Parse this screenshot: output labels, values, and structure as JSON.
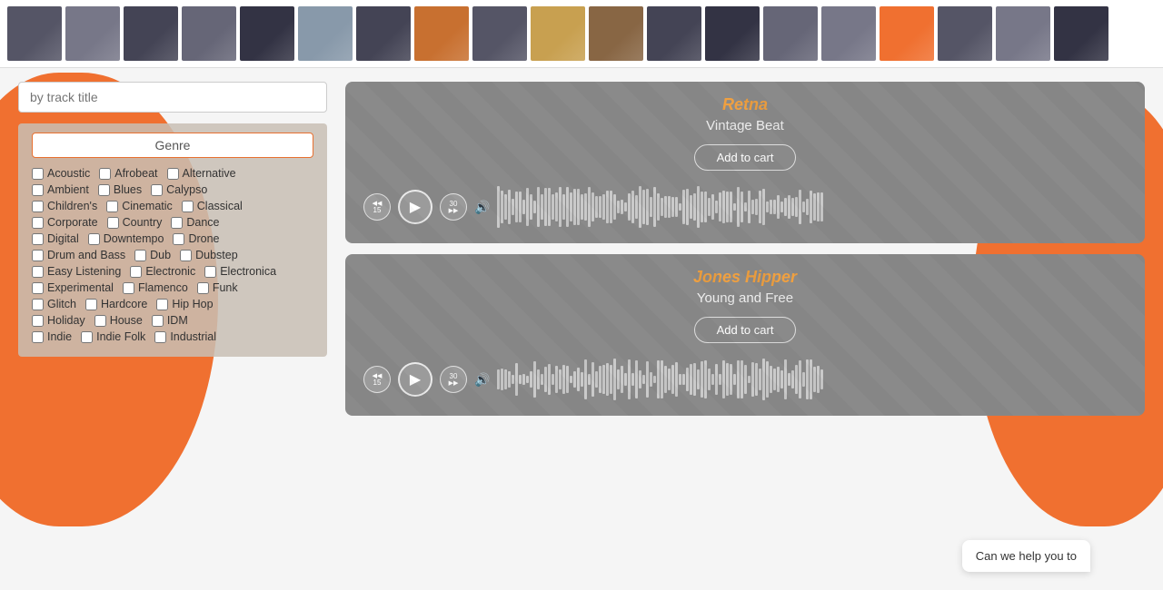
{
  "banner": {
    "items": [
      {
        "id": 1,
        "color": "#555"
      },
      {
        "id": 2,
        "color": "#666"
      },
      {
        "id": 3,
        "color": "#444"
      },
      {
        "id": 4,
        "color": "#888"
      },
      {
        "id": 5,
        "color": "#333"
      },
      {
        "id": 6,
        "color": "#777"
      },
      {
        "id": 7,
        "color": "#555"
      },
      {
        "id": 8,
        "color": "#e87030"
      },
      {
        "id": 9,
        "color": "#666"
      },
      {
        "id": 10,
        "color": "#c8b060"
      },
      {
        "id": 11,
        "color": "#886644"
      },
      {
        "id": 12,
        "color": "#555"
      },
      {
        "id": 13,
        "color": "#444"
      },
      {
        "id": 14,
        "color": "#777"
      },
      {
        "id": 15,
        "color": "#888"
      },
      {
        "id": 16,
        "color": "#e87030"
      },
      {
        "id": 17,
        "color": "#555"
      },
      {
        "id": 18,
        "color": "#666"
      },
      {
        "id": 19,
        "color": "#444"
      }
    ]
  },
  "search": {
    "placeholder": "by track title",
    "value": ""
  },
  "genre_panel": {
    "header": "Genre",
    "genres": [
      "Acoustic",
      "Afrobeat",
      "Alternative",
      "Ambient",
      "Blues",
      "Calypso",
      "Children's",
      "Cinematic",
      "Classical",
      "Corporate",
      "Country",
      "Dance",
      "Digital",
      "Downtempo",
      "Drone",
      "Drum and Bass",
      "Dub",
      "Dubstep",
      "Easy Listening",
      "Electronic",
      "Electronica",
      "Experimental",
      "Flamenco",
      "Funk",
      "Glitch",
      "Hardcore",
      "Hip Hop",
      "Holiday",
      "House",
      "IDM",
      "Indie",
      "Indie Folk",
      "Industrial"
    ]
  },
  "tracks": [
    {
      "artist": "Retna",
      "title": "Vintage Beat",
      "add_to_cart_label": "Add to cart",
      "skip_back_label": "15",
      "skip_forward_label": "30"
    },
    {
      "artist": "Jones Hipper",
      "title": "Young and Free",
      "add_to_cart_label": "Add to cart",
      "skip_back_label": "15",
      "skip_forward_label": "30"
    }
  ],
  "chat": {
    "text": "Can we help you to"
  },
  "icons": {
    "play": "▶",
    "skip_back": "⟪",
    "skip_forward": "⟫",
    "volume": "🔊"
  }
}
